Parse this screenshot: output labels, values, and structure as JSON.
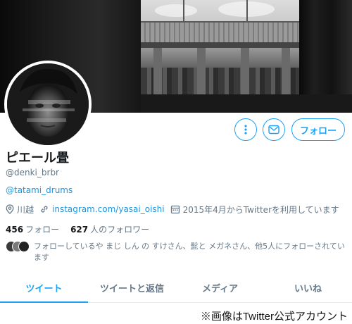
{
  "colors": {
    "accent": "#1da1f2",
    "link": "#1b95e0",
    "muted": "#657786",
    "text": "#14171a"
  },
  "profile": {
    "display_name": "ピエール畳",
    "handle": "@denki_brbr",
    "bio_link": "@tatami_drums",
    "location": "川越",
    "website": "instagram.com/yasai_oishi",
    "joined": "2015年4月からTwitterを利用しています"
  },
  "icons": {
    "more": "more-vertical-icon",
    "message": "envelope-icon",
    "location": "location-pin-icon",
    "website": "link-icon",
    "joined": "calendar-icon"
  },
  "actions": {
    "follow_label": "フォロー"
  },
  "stats": {
    "following_count": "456",
    "following_label": "フォロー",
    "followers_count": "627",
    "followers_label": "人のフォロワー"
  },
  "followers_you_know": "フォローしているや まじ しん の すけさん、髭と メガネさん、他5人にフォローされています",
  "tabs": [
    {
      "label": "ツイート",
      "active": true
    },
    {
      "label": "ツイートと返信",
      "active": false
    },
    {
      "label": "メディア",
      "active": false
    },
    {
      "label": "いいね",
      "active": false
    }
  ],
  "caption": "※画像はTwitter公式アカウント"
}
